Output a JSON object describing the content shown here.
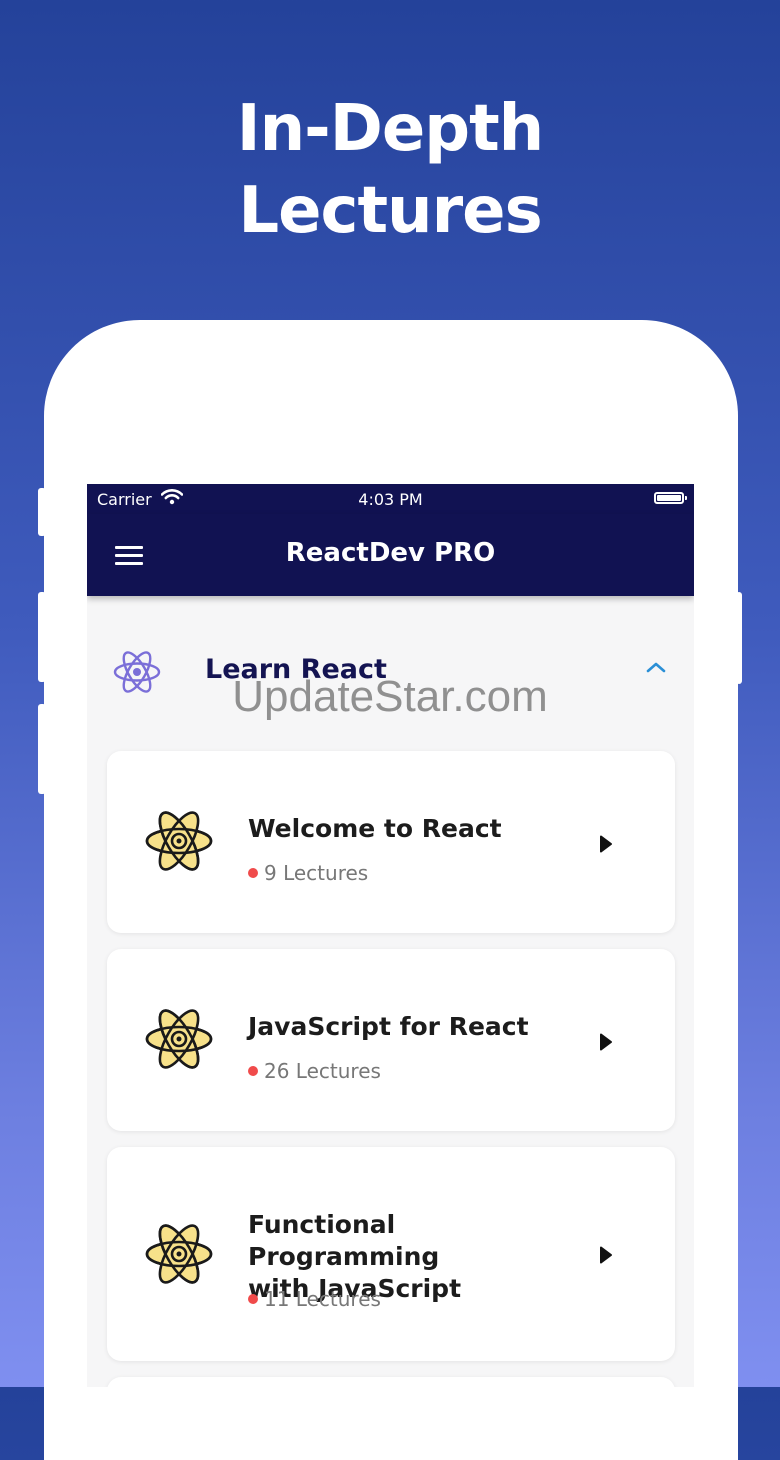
{
  "headline": {
    "line1": "In-Depth",
    "line2": "Lectures"
  },
  "status_bar": {
    "carrier": "Carrier",
    "time": "4:03 PM"
  },
  "navbar": {
    "title": "ReactDev PRO"
  },
  "section": {
    "label": "Learn React",
    "expanded": true
  },
  "watermark": "UpdateStar.com",
  "courses": [
    {
      "title_line1": "Welcome to React",
      "title_line2": "",
      "lectures": "9 Lectures"
    },
    {
      "title_line1": "JavaScript for React",
      "title_line2": "",
      "lectures": "26 Lectures"
    },
    {
      "title_line1": "Functional Programming",
      "title_line2": "with JavaScript",
      "lectures": "11 Lectures"
    }
  ],
  "colors": {
    "navbar": "#111252",
    "accent": "#2a8fd6",
    "dot": "#f04b4b",
    "react_purple": "#7b6fd8",
    "atom_yellow": "#f7e18a"
  }
}
